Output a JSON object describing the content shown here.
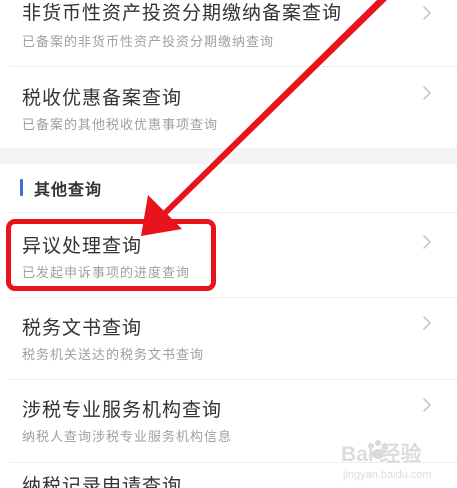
{
  "items": [
    {
      "title": "非货币性资产投资分期缴纳备案查询",
      "subtitle": "已备案的非货币性资产投资分期缴纳查询"
    },
    {
      "title": "税收优惠备案查询",
      "subtitle": "已备案的其他税收优惠事项查询"
    }
  ],
  "section": {
    "title": "其他查询"
  },
  "section_items": [
    {
      "title": "异议处理查询",
      "subtitle": "已发起申诉事项的进度查询"
    },
    {
      "title": "税务文书查询",
      "subtitle": "税务机关送达的税务文书查询"
    },
    {
      "title": "涉税专业服务机构查询",
      "subtitle": "纳税人查询涉税专业服务机构信息"
    },
    {
      "title": "纳税记录申请查询",
      "subtitle": ""
    }
  ],
  "watermark": {
    "text": "Bai 经验",
    "subtext": "jingyan.baidu.com"
  },
  "colors": {
    "accent": "#3b6fe0",
    "annotation_red": "#e8131b",
    "title_text": "#333333",
    "subtitle_text": "#a0a0a0",
    "gap_background": "#f4f5f7"
  },
  "icons": {
    "chevron": "chevron-right-icon",
    "annotation_arrow": "arrow-icon",
    "watermark_paw": "paw-icon"
  }
}
